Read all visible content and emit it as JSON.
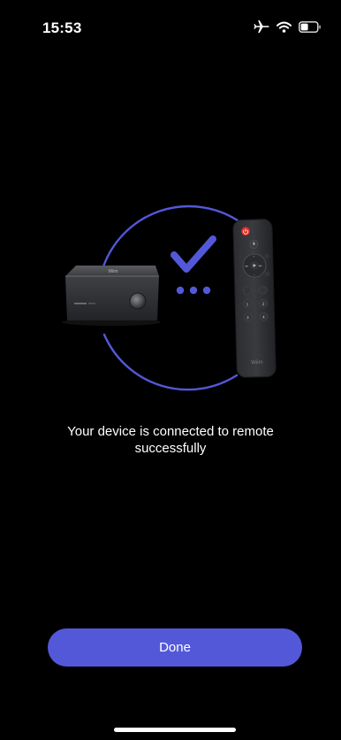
{
  "status_bar": {
    "time": "15:53",
    "icons": [
      "airplane-icon",
      "wifi-icon",
      "battery-icon"
    ]
  },
  "illustration": {
    "device_brand": "Wiim",
    "accent_color": "#5358d9",
    "power_color": "#e0302a"
  },
  "message": {
    "text": "Your device is connected to remote successfully"
  },
  "done_button": {
    "label": "Done",
    "color": "#5358d9"
  }
}
